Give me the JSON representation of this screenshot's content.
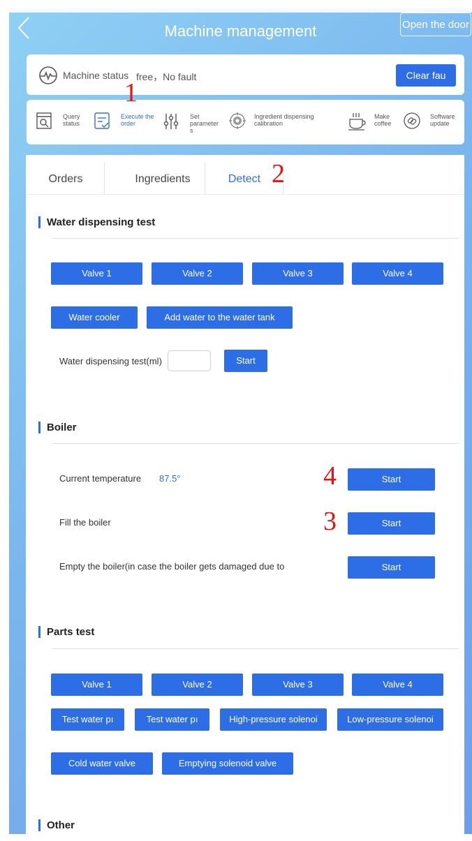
{
  "header": {
    "title": "Machine management",
    "open_door": "Open the door"
  },
  "status": {
    "label": "Machine status",
    "value": "free，No fault",
    "clear_button": "Clear fau"
  },
  "nav": {
    "items": [
      {
        "label": "Query\nstatus"
      },
      {
        "label": "Execute the\norder"
      },
      {
        "label": "Set\nparameter\ns"
      },
      {
        "label": "Ingredient dispensing\ncalibration"
      },
      {
        "label": "Make\ncoffee"
      },
      {
        "label": "Software\nupdate"
      }
    ]
  },
  "annotations": [
    "1",
    "2",
    "3",
    "4"
  ],
  "tabs": [
    "Orders",
    "Ingredients",
    "Detect"
  ],
  "water_test": {
    "title": "Water dispensing test",
    "valves": [
      "Valve 1",
      "Valve 2",
      "Valve 3",
      "Valve 4"
    ],
    "cooler": "Water cooler",
    "add_water": "Add water to the water tank",
    "ml_label": "Water dispensing test(ml)",
    "ml_value": "",
    "start": "Start"
  },
  "boiler": {
    "title": "Boiler",
    "current_temp_label": "Current temperature",
    "current_temp_value": "87.5°",
    "fill_label": "Fill the boiler",
    "empty_label": "Empty the boiler(in case the boiler gets damaged due to",
    "start": "Start"
  },
  "parts_test": {
    "title": "Parts test",
    "valves": [
      "Valve 1",
      "Valve 2",
      "Valve 3",
      "Valve 4"
    ],
    "row2": [
      "Test water pı",
      "Test water pı",
      "High-pressure solenoi",
      "Low-pressure solenoi"
    ],
    "cold_valve": "Cold water valve",
    "emptying_valve": "Emptying solenoid valve"
  },
  "other": {
    "title": "Other"
  },
  "colors": {
    "accent": "#2d6ee6",
    "annotation": "#e21414",
    "background_start": "#8fd0f4",
    "background_end": "#6e9ee8"
  }
}
